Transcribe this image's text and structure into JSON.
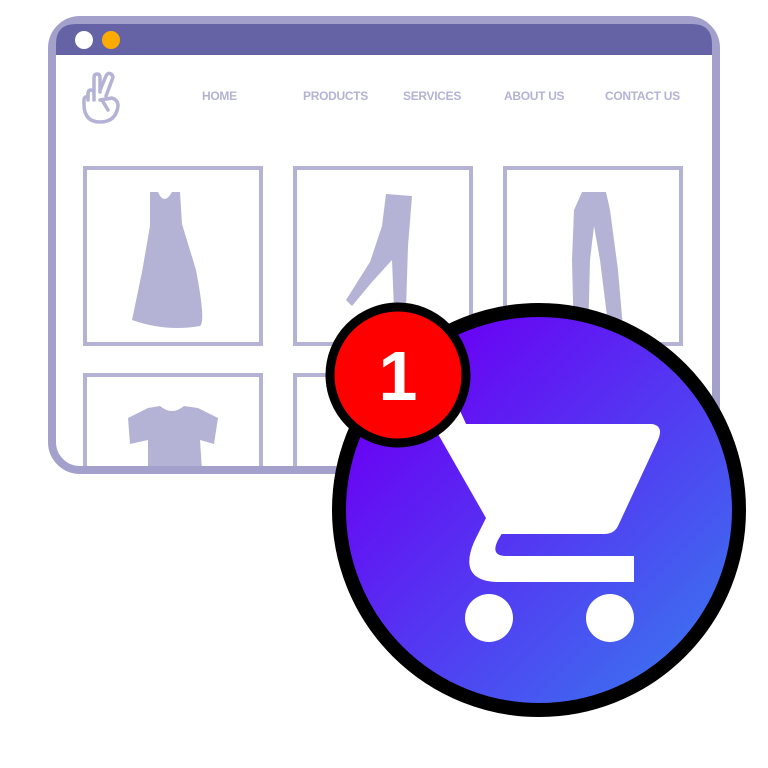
{
  "window": {
    "dots": [
      {
        "color": "#ffffff"
      },
      {
        "color": "#ffaa00"
      }
    ],
    "frame_color": "#a3a1cb",
    "titlebar_color": "#6563a5"
  },
  "site": {
    "logo_icon": "peace-hand-icon",
    "nav": [
      "HOME",
      "PRODUCTS",
      "SERVICES",
      "ABOUT US",
      "CONTACT US"
    ],
    "products": [
      "dress-icon",
      "leggings-icon",
      "pants-icon",
      "tshirt-icon",
      "item-icon"
    ]
  },
  "cart": {
    "icon": "shopping-cart-icon",
    "gradient": [
      "#6a00f4",
      "#3f6af0"
    ],
    "badge_count": "1",
    "badge_color": "#ff0000"
  }
}
